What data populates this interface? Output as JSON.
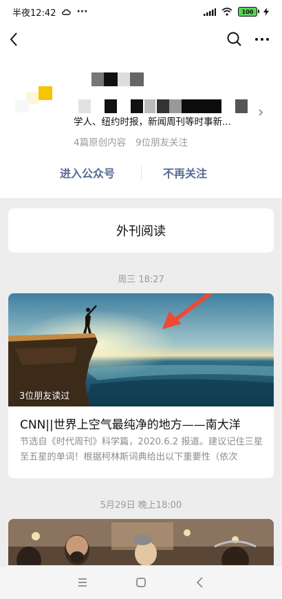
{
  "status_bar": {
    "time": "半夜12:42",
    "dots": "···",
    "battery": "100"
  },
  "profile": {
    "description": "学人、纽约时报，新闻周刊等时事新...",
    "stats": [
      "4篇原创内容",
      "9位朋友关注"
    ],
    "actions": {
      "enter": "进入公众号",
      "unfollow": "不再关注"
    }
  },
  "featured": {
    "title": "外刊阅读"
  },
  "feed": [
    {
      "date": "周三 18:27",
      "readers": "3位朋友读过",
      "title": "CNN||世界上空气最纯净的地方——南大洋",
      "summary": "节选自《时代周刊》科学篇，2020.6.2 报道。建议记住三星至五星的单词！根据柯林斯词典给出以下重要性（依次"
    },
    {
      "date": "5月29日 晚上18:00"
    }
  ],
  "colors": {
    "link": "#576b95",
    "arrow": "#ee4a34",
    "badge": "#f6c400"
  }
}
